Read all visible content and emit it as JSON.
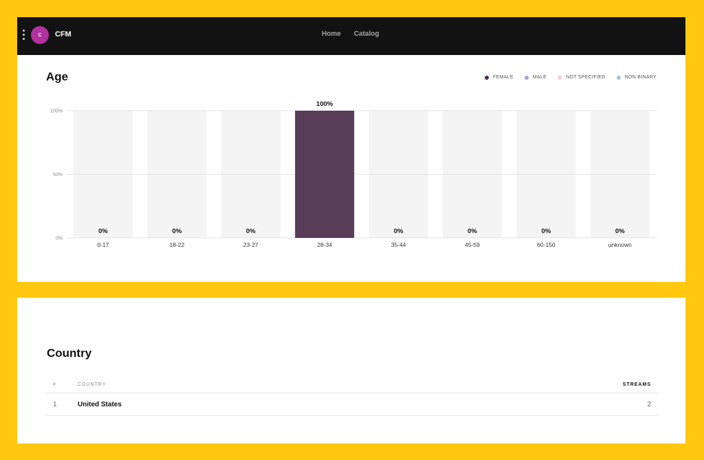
{
  "header": {
    "avatar_initial": "C",
    "artist_name": "CFM",
    "nav": [
      {
        "label": "Home"
      },
      {
        "label": "Catalog"
      }
    ]
  },
  "age_section": {
    "title": "Age"
  },
  "colors": {
    "background": "#FFC80F",
    "header": "#121212",
    "avatar": "#B1319F",
    "bar_fill": "#573D57",
    "bar_track": "#F4F4F4"
  },
  "chart_data": {
    "type": "bar",
    "title": "Age",
    "xlabel": "",
    "ylabel": "",
    "ylim": [
      0,
      100
    ],
    "yticks": [
      "0%",
      "50%",
      "100%"
    ],
    "ytick_values": [
      0,
      50,
      100
    ],
    "grid": true,
    "legend_position": "top-right",
    "legend": [
      {
        "label": "FEMALE",
        "color": "#3F3049"
      },
      {
        "label": "MALE",
        "color": "#AFA2D1"
      },
      {
        "label": "NOT SPECIFIED",
        "color": "#F6CCD3"
      },
      {
        "label": "NON BINARY",
        "color": "#A9C6D4"
      }
    ],
    "categories": [
      "0-17",
      "18-22",
      "23-27",
      "28-34",
      "35-44",
      "45-59",
      "60-150",
      "unknown"
    ],
    "values": [
      0,
      0,
      0,
      100,
      0,
      0,
      0,
      0
    ],
    "value_labels": [
      "0%",
      "0%",
      "0%",
      "100%",
      "0%",
      "0%",
      "0%",
      "0%"
    ]
  },
  "country_section": {
    "title": "Country",
    "columns": {
      "num": "#",
      "country": "COUNTRY",
      "streams": "STREAMS"
    },
    "rows": [
      {
        "num": "1",
        "country": "United States",
        "streams": "2"
      }
    ]
  }
}
